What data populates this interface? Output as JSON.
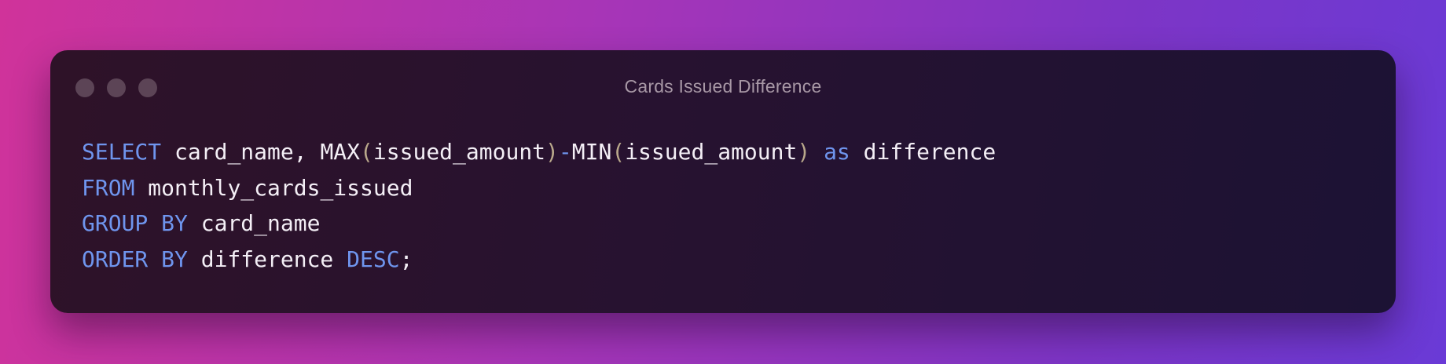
{
  "window": {
    "title": "Cards Issued Difference"
  },
  "code": {
    "lines": [
      [
        {
          "t": "SELECT",
          "k": "kw"
        },
        {
          "t": " card_name, MAX",
          "k": "plain"
        },
        {
          "t": "(",
          "k": "paren"
        },
        {
          "t": "issued_amount",
          "k": "plain"
        },
        {
          "t": ")",
          "k": "paren"
        },
        {
          "t": "-",
          "k": "kw"
        },
        {
          "t": "MIN",
          "k": "plain"
        },
        {
          "t": "(",
          "k": "paren"
        },
        {
          "t": "issued_amount",
          "k": "plain"
        },
        {
          "t": ")",
          "k": "paren"
        },
        {
          "t": " ",
          "k": "plain"
        },
        {
          "t": "as",
          "k": "kw"
        },
        {
          "t": " difference",
          "k": "plain"
        }
      ],
      [
        {
          "t": "FROM",
          "k": "kw"
        },
        {
          "t": " monthly_cards_issued",
          "k": "plain"
        }
      ],
      [
        {
          "t": "GROUP BY",
          "k": "kw"
        },
        {
          "t": " card_name",
          "k": "plain"
        }
      ],
      [
        {
          "t": "ORDER BY",
          "k": "kw"
        },
        {
          "t": " difference ",
          "k": "plain"
        },
        {
          "t": "DESC",
          "k": "kw"
        },
        {
          "t": ";",
          "k": "plain"
        }
      ]
    ]
  },
  "colors": {
    "keyword": "#6f95ee",
    "paren": "#b9a88b",
    "text": "#f4eff6",
    "title": "#a898a6",
    "window_dot": "#5c4456"
  }
}
